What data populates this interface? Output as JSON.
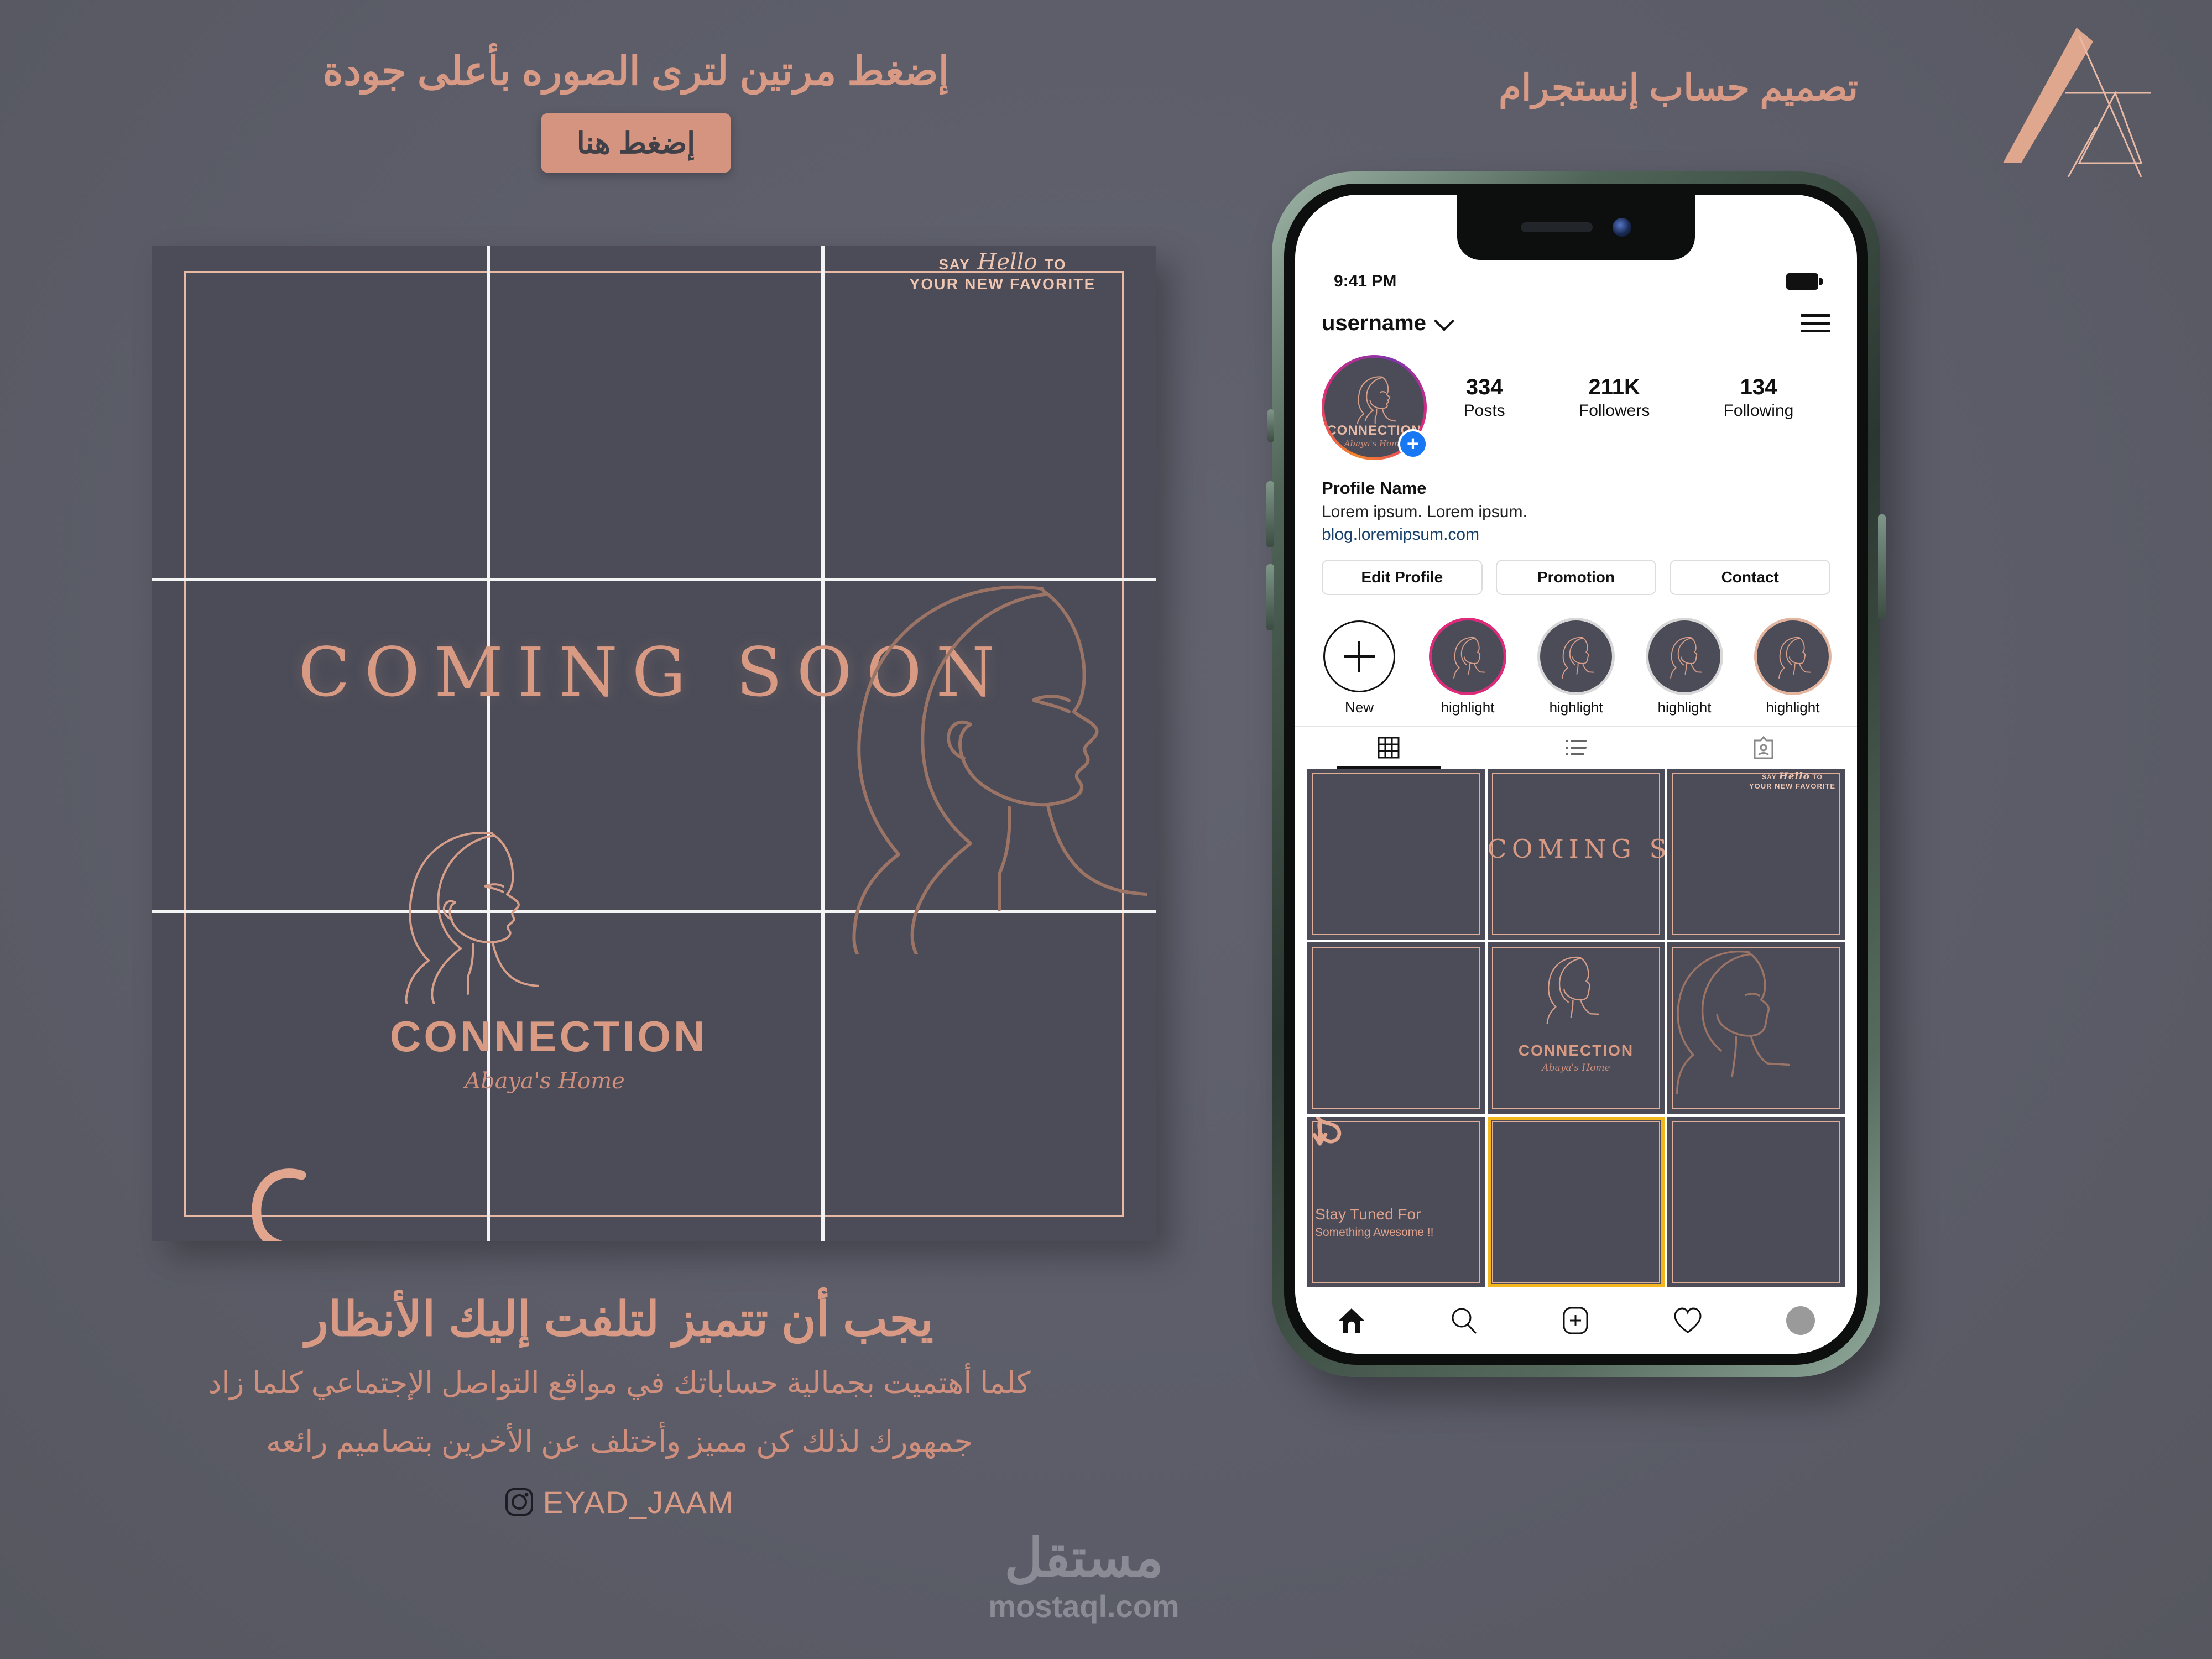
{
  "promo": {
    "title": "إضغط مرتين لترى الصوره بأعلى جودة",
    "button_label": "إضغط هنا"
  },
  "right_title": "تصميم حساب إنستجرام",
  "poster": {
    "say_hello": {
      "prefix": "SAY",
      "script": "Hello",
      "suffix": "TO",
      "line2": "YOUR NEW FAVORITE"
    },
    "coming_soon": "COMING SOON",
    "logo_name": "CONNECTION",
    "logo_tagline": "Abaya's Home",
    "stay_tuned_line1": "Stay Tuned For",
    "stay_tuned_line2": "Something Awesome !!"
  },
  "bottom": {
    "heading": "يجب أن تتميز لتلفت إليك الأنظار",
    "body_line1": "كلما أهتميت بجمالية حساباتك في مواقع التواصل الإجتماعي كلما زاد",
    "body_line2": "جمهورك لذلك كن مميز وأختلف عن الأخرين بتصاميم رائعه",
    "handle": "EYAD_JAAM"
  },
  "watermark": {
    "arabic": "مستقل",
    "latin": "mostaql.com"
  },
  "phone": {
    "status": {
      "time": "9:41 PM",
      "battery_icon": "battery-full-icon"
    },
    "header": {
      "username": "username",
      "chevron_icon": "chevron-down-icon",
      "menu_icon": "hamburger-menu-icon"
    },
    "profile": {
      "avatar_name": "CONNECTION",
      "avatar_tagline": "Abaya's Home",
      "add_story_icon": "plus-circle-icon",
      "stats": [
        {
          "value": "334",
          "label": "Posts"
        },
        {
          "value": "211K",
          "label": "Followers"
        },
        {
          "value": "134",
          "label": "Following"
        }
      ]
    },
    "bio": {
      "name": "Profile Name",
      "description": "Lorem ipsum. Lorem ipsum.",
      "link": "blog.loremipsum.com"
    },
    "actions": [
      "Edit Profile",
      "Promotion",
      "Contact"
    ],
    "highlights": [
      {
        "label": "New",
        "type": "new"
      },
      {
        "label": "highlight",
        "type": "gradient"
      },
      {
        "label": "highlight",
        "type": "plain"
      },
      {
        "label": "highlight",
        "type": "plain"
      },
      {
        "label": "highlight",
        "type": "rose"
      }
    ],
    "tabs": [
      {
        "icon": "grid-icon",
        "active": true
      },
      {
        "icon": "list-icon",
        "active": false
      },
      {
        "icon": "tagged-icon",
        "active": false
      }
    ],
    "nav": [
      {
        "icon": "home-icon",
        "active": true
      },
      {
        "icon": "search-icon",
        "active": false
      },
      {
        "icon": "add-post-icon",
        "active": false
      },
      {
        "icon": "heart-icon",
        "active": false
      },
      {
        "icon": "profile-avatar-icon",
        "active": false
      }
    ]
  },
  "colors": {
    "page_bg": "#5e5f6b",
    "poster_bg": "#4b4c58",
    "accent_rose": "#d89a85",
    "accent_light": "#e8b9a4",
    "selection_gold": "#f3b61c",
    "link_blue": "#17406b"
  }
}
